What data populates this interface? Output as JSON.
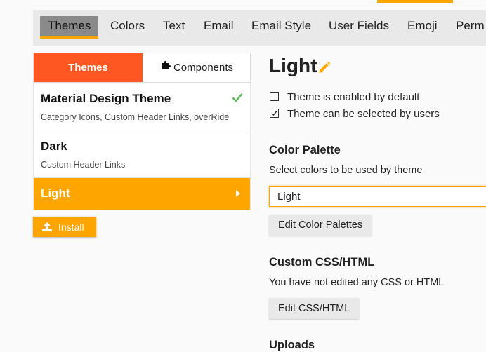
{
  "nav": {
    "items": [
      "Themes",
      "Colors",
      "Text",
      "Email",
      "Email Style",
      "User Fields",
      "Emoji",
      "Perm"
    ]
  },
  "tabs": {
    "themes": "Themes",
    "components": "Components"
  },
  "themes": [
    {
      "name": "Material Design Theme",
      "sub": "Category Icons, Custom Header Links, overRide",
      "default": true
    },
    {
      "name": "Dark",
      "sub": "Custom Header Links"
    },
    {
      "name": "Light",
      "selected": true
    }
  ],
  "install_label": "Install",
  "detail": {
    "title": "Light",
    "checkbox_default": "Theme is enabled by default",
    "checkbox_selectable": "Theme can be selected by users",
    "palette_title": "Color Palette",
    "palette_desc": "Select colors to be used by theme",
    "palette_value": "Light",
    "edit_palettes": "Edit Color Palettes",
    "css_title": "Custom CSS/HTML",
    "css_desc": "You have not edited any CSS or HTML",
    "edit_css": "Edit CSS/HTML",
    "uploads_title": "Uploads"
  },
  "colors": {
    "accent": "#ffa500",
    "tab_active": "#ff5722",
    "check": "#5cb85c"
  }
}
